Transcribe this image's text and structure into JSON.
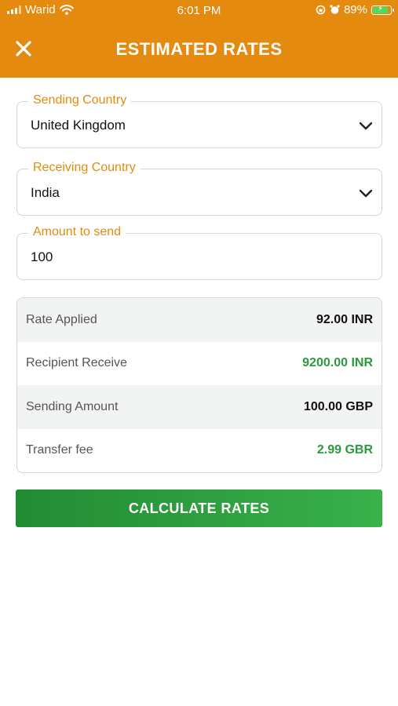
{
  "status_bar": {
    "carrier": "Warid",
    "time": "6:01 PM",
    "battery_percent": "89%"
  },
  "header": {
    "title": "ESTIMATED RATES",
    "close_icon": "close-icon",
    "background_color": "#e48a0e"
  },
  "form": {
    "sending_country": {
      "label": "Sending Country",
      "value": "United Kingdom"
    },
    "receiving_country": {
      "label": "Receiving Country",
      "value": "India"
    },
    "amount": {
      "label": "Amount to send",
      "value": "100"
    }
  },
  "rates": [
    {
      "label": "Rate Applied",
      "value": "92.00 INR",
      "highlight": false
    },
    {
      "label": "Recipient Receive",
      "value": "9200.00 INR",
      "highlight": true
    },
    {
      "label": "Sending Amount",
      "value": "100.00 GBP",
      "highlight": false
    },
    {
      "label": "Transfer fee",
      "value": "2.99 GBR",
      "highlight": true
    }
  ],
  "calculate_button": {
    "label": "CALCULATE RATES",
    "color": "#2a9a3a"
  }
}
